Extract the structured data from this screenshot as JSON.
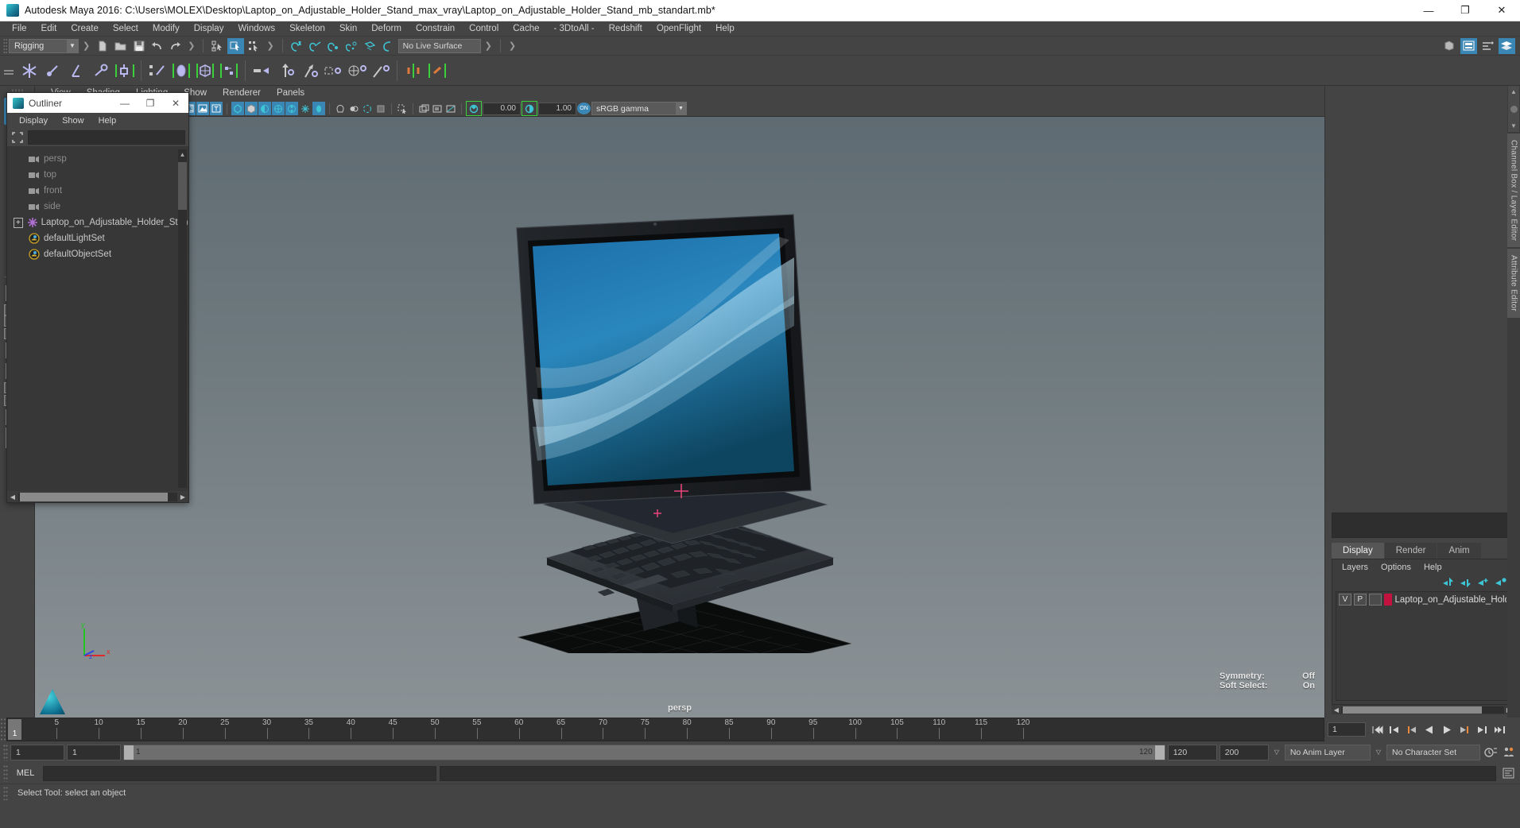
{
  "window": {
    "title": "Autodesk Maya 2016: C:\\Users\\MOLEX\\Desktop\\Laptop_on_Adjustable_Holder_Stand_max_vray\\Laptop_on_Adjustable_Holder_Stand_mb_standart.mb*",
    "minimize": "—",
    "maximize": "❐",
    "close": "✕"
  },
  "menubar": {
    "items": [
      {
        "label": "File"
      },
      {
        "label": "Edit"
      },
      {
        "label": "Create"
      },
      {
        "label": "Select"
      },
      {
        "label": "Modify"
      },
      {
        "label": "Display"
      },
      {
        "label": "Windows"
      },
      {
        "label": "Skeleton"
      },
      {
        "label": "Skin"
      },
      {
        "label": "Deform"
      },
      {
        "label": "Constrain"
      },
      {
        "label": "Control"
      },
      {
        "label": "Cache"
      },
      {
        "label": "- 3DtoAll -"
      },
      {
        "label": "Redshift"
      },
      {
        "label": "OpenFlight"
      },
      {
        "label": "Help"
      }
    ]
  },
  "statusline": {
    "menuset": "Rigging",
    "menuset_arrow": "▼",
    "live_surface": "No Live Surface",
    "chevron": "❯"
  },
  "panelmenu": {
    "items": [
      {
        "label": "View"
      },
      {
        "label": "Shading"
      },
      {
        "label": "Lighting"
      },
      {
        "label": "Show"
      },
      {
        "label": "Renderer"
      },
      {
        "label": "Panels"
      }
    ]
  },
  "viewport_toolbar": {
    "exposure_value": "0.00",
    "gamma_value": "1.00",
    "color_toggle": "ON",
    "color_profile": "sRGB gamma",
    "profile_arrow": "▼"
  },
  "viewport": {
    "camera_label": "persp",
    "hud": [
      {
        "label": "Symmetry:",
        "value": "Off"
      },
      {
        "label": "Soft Select:",
        "value": "On"
      }
    ],
    "axis": {
      "x": "x",
      "y": "y",
      "z": "z"
    }
  },
  "outliner": {
    "title": "Outliner",
    "window_buttons": {
      "minimize": "—",
      "maximize": "❐",
      "close": "✕"
    },
    "menu": [
      {
        "label": "Display"
      },
      {
        "label": "Show"
      },
      {
        "label": "Help"
      }
    ],
    "search_value": "",
    "items": [
      {
        "name": "persp",
        "icon": "camera-icon",
        "dim": true,
        "expandable": false
      },
      {
        "name": "top",
        "icon": "camera-icon",
        "dim": true,
        "expandable": false
      },
      {
        "name": "front",
        "icon": "camera-icon",
        "dim": true,
        "expandable": false
      },
      {
        "name": "side",
        "icon": "camera-icon",
        "dim": true,
        "expandable": false
      },
      {
        "name": "Laptop_on_Adjustable_Holder_Stand_nc",
        "icon": "transform-icon",
        "dim": false,
        "expandable": true,
        "expand_glyph": "+"
      },
      {
        "name": "defaultLightSet",
        "icon": "set-icon",
        "dim": false,
        "expandable": false
      },
      {
        "name": "defaultObjectSet",
        "icon": "set-icon",
        "dim": false,
        "expandable": false
      }
    ]
  },
  "right_dock": {
    "tabs": [
      {
        "label": "Display",
        "active": true
      },
      {
        "label": "Render",
        "active": false
      },
      {
        "label": "Anim",
        "active": false
      }
    ],
    "layer_menu": [
      {
        "label": "Layers"
      },
      {
        "label": "Options"
      },
      {
        "label": "Help"
      }
    ],
    "layers": [
      {
        "visibility": "V",
        "playback": "P",
        "state": "",
        "color": "#c3123e",
        "name": "Laptop_on_Adjustable_Holder_Star"
      }
    ],
    "vertical_tabs": [
      {
        "label": "Channel Box / Layer Editor"
      },
      {
        "label": "Attribute Editor"
      }
    ]
  },
  "timeline": {
    "current_frame": "1",
    "ticks": [
      5,
      10,
      15,
      20,
      25,
      30,
      35,
      40,
      45,
      50,
      55,
      60,
      65,
      70,
      75,
      80,
      85,
      90,
      95,
      100,
      105,
      110,
      115,
      120
    ],
    "start": 1,
    "end": 120,
    "frame_field": "1"
  },
  "range": {
    "anim_start": "1",
    "range_start": "1",
    "bar_start_label": "1",
    "bar_end_label": "120",
    "range_end": "120",
    "anim_end": "200",
    "anim_layer": "No Anim Layer",
    "character_set": "No Character Set",
    "arrow": "▽"
  },
  "mel": {
    "label": "MEL",
    "command_value": "",
    "output_value": ""
  },
  "helpline": {
    "text": "Select Tool: select an object"
  },
  "colors": {
    "accent_blue": "#3a86b5",
    "shelf_purple": "#b9b9ef",
    "highlight_green": "#39d039",
    "layer_red": "#c3123e",
    "cyan_icon": "#3fc6d6"
  }
}
